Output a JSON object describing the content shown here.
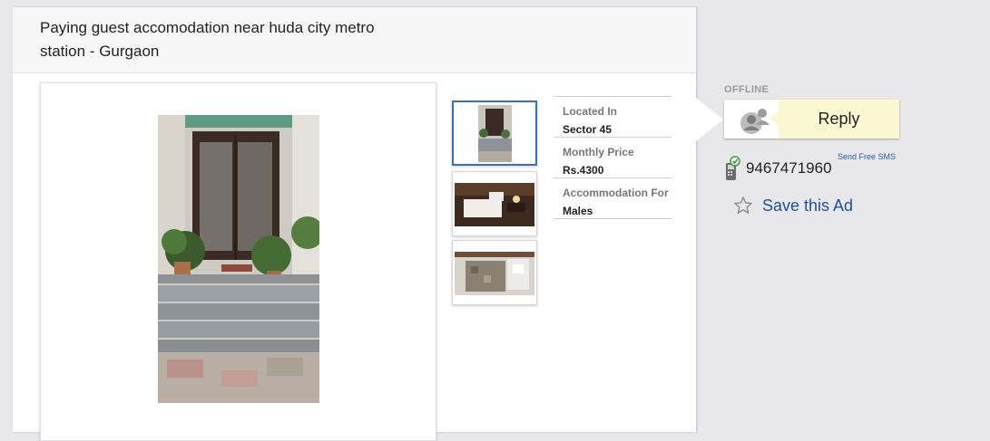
{
  "ad": {
    "title": "Paying guest accomodation near huda city metro station - Gurgaon"
  },
  "gallery": {
    "main_image": "entrance-with-stairs-and-plants",
    "thumbnails": [
      {
        "name": "entrance-stairs",
        "active": true
      },
      {
        "name": "bedroom",
        "active": false
      },
      {
        "name": "bathroom",
        "active": false
      }
    ]
  },
  "attributes": [
    {
      "label": "Located In",
      "value": "Sector 45"
    },
    {
      "label": "Monthly Price",
      "value": "Rs.4300"
    },
    {
      "label": "Accommodation For",
      "value": "Males"
    }
  ],
  "seller": {
    "status": "OFFLINE",
    "reply_label": "Reply",
    "phone": "9467471960",
    "sms_link": "Send Free SMS",
    "save_label": "Save this Ad",
    "avatar_icon": "user-avatar-icon",
    "phone_icon": "verified-phone-icon",
    "save_icon": "star-icon"
  },
  "colors": {
    "reply_bg": "#fbf7d0",
    "link": "#1f4f9e",
    "active_thumb_border": "#3b6fb6",
    "page_bg": "#e8e8ea"
  }
}
